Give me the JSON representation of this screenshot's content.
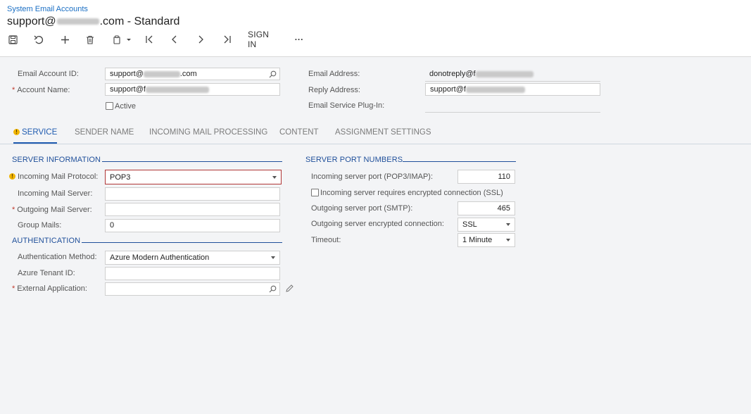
{
  "header": {
    "breadcrumb": "System Email Accounts",
    "title_prefix": "support@",
    "title_suffix": ".com - Standard"
  },
  "toolbar": {
    "sign_in_label": "SIGN IN",
    "more_label": "···"
  },
  "summary": {
    "email_account_id_label": "Email Account ID:",
    "email_account_id_value": "support@",
    "email_account_id_value_tail": ".com",
    "account_name_label": "Account Name:",
    "account_name_value": "support@f",
    "active_label": "Active",
    "email_address_label": "Email Address:",
    "email_address_value": "donotreply@f",
    "reply_address_label": "Reply Address:",
    "reply_address_value": "support@f",
    "plugin_label": "Email Service Plug-In:"
  },
  "tabs": [
    {
      "label": "SERVICE",
      "active": true,
      "warning": true
    },
    {
      "label": "SENDER NAME"
    },
    {
      "label": "INCOMING MAIL PROCESSING"
    },
    {
      "label": "CONTENT"
    },
    {
      "label": "ASSIGNMENT SETTINGS"
    }
  ],
  "server_info": {
    "title": "SERVER INFORMATION",
    "incoming_protocol_label": "Incoming Mail Protocol:",
    "incoming_protocol_value": "POP3",
    "incoming_server_label": "Incoming Mail Server:",
    "incoming_server_value": "",
    "outgoing_server_label": "Outgoing Mail Server:",
    "outgoing_server_value": "",
    "group_mails_label": "Group Mails:",
    "group_mails_value": "0"
  },
  "authentication": {
    "title": "AUTHENTICATION",
    "method_label": "Authentication Method:",
    "method_value": "Azure Modern Authentication",
    "tenant_label": "Azure Tenant ID:",
    "tenant_value": "",
    "external_app_label": "External Application:",
    "external_app_value": ""
  },
  "ports": {
    "title": "SERVER PORT NUMBERS",
    "incoming_port_label": "Incoming server port (POP3/IMAP):",
    "incoming_port_value": "110",
    "ssl_label": "Incoming server requires encrypted connection (SSL)",
    "outgoing_port_label": "Outgoing server port (SMTP):",
    "outgoing_port_value": "465",
    "outgoing_encryption_label": "Outgoing server encrypted connection:",
    "outgoing_encryption_value": "SSL",
    "timeout_label": "Timeout:",
    "timeout_value": "1 Minute"
  },
  "colors": {
    "accent": "#1f5bb0",
    "link": "#1a6fc4",
    "error_border": "#b03636",
    "warning": "#f0b400",
    "required": "#c0392b"
  }
}
